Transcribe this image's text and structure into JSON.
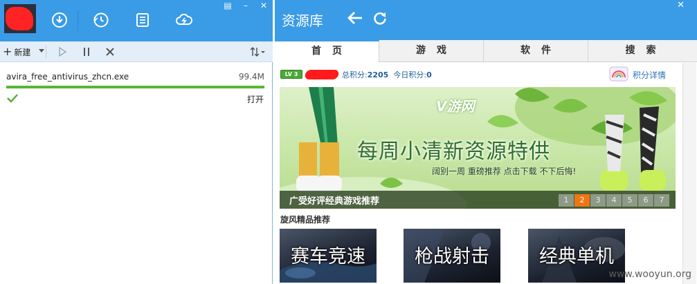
{
  "left_panel": {
    "window_buttons": [
      "▤",
      "–",
      "✕"
    ],
    "toolbar_icons": [
      "download-icon",
      "history-icon",
      "list-icon",
      "cloud-icon"
    ],
    "controls": {
      "new_label": "新建",
      "icons": [
        "play-icon",
        "pause-icon",
        "delete-icon",
        "sort-icon"
      ]
    },
    "downloads": [
      {
        "filename": "avira_free_antivirus_zhcn.exe",
        "size": "99.4M",
        "progress": 1.0,
        "status_icon": "check-icon",
        "action_label": "打开"
      }
    ]
  },
  "right_panel": {
    "title": "资源库",
    "close_label": "✕",
    "tabs": [
      "首页",
      "游戏",
      "软件",
      "搜索"
    ],
    "active_tab": 0,
    "score": {
      "level": "LV 3",
      "total_label": "总积分:",
      "total_value": "2205",
      "today_label": "今日积分:",
      "today_value": "0",
      "detail_link": "积分详情"
    },
    "banner": {
      "logo": "V游网",
      "headline": "每周小清新资源特供",
      "subline": "阔别一周 重磅推荐 点击下载 不下后悔!",
      "caption": "广受好评经典游戏推荐",
      "pages": [
        "1",
        "2",
        "3",
        "4",
        "5",
        "6",
        "7"
      ],
      "active_page": 1
    },
    "section_title": "旋风精品推荐",
    "categories": [
      {
        "label": "赛车竞速"
      },
      {
        "label": "枪战射击"
      },
      {
        "label": "经典单机"
      }
    ],
    "watermark": "www.wooyun.org"
  },
  "colors": {
    "title_blue": "#3a9be6",
    "progress_green": "#58b633",
    "pager_active": "#f07613",
    "link_blue": "#2a72b8"
  }
}
